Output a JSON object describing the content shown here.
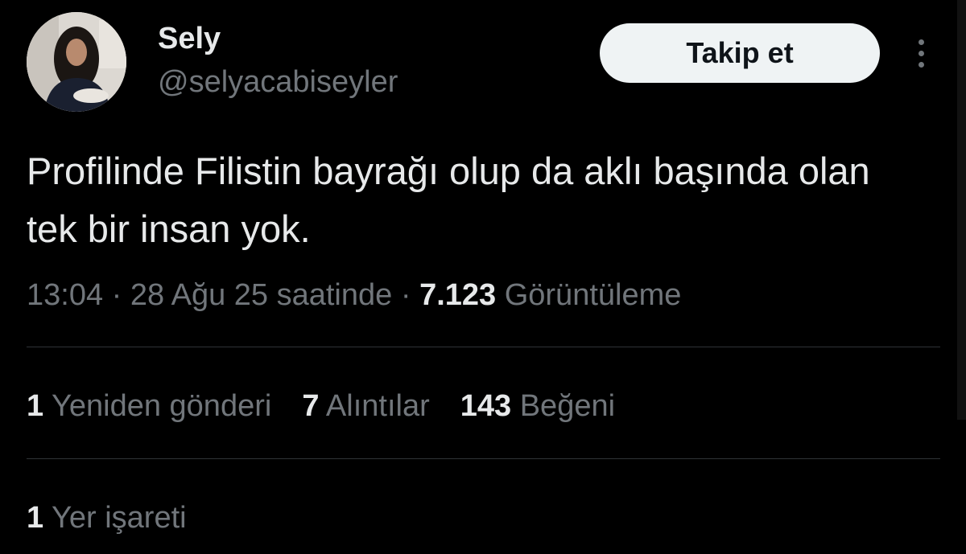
{
  "author": {
    "display_name": "Sely",
    "handle": "@selyacabiseyler",
    "avatar_icon": "user-avatar-photo"
  },
  "follow_button": {
    "label": "Takip et"
  },
  "more_icon": "more-vertical-icon",
  "tweet": {
    "text": "Profilinde Filistin bayrağı olup da aklı başında olan tek bir insan yok."
  },
  "meta": {
    "time": "13:04",
    "sep1": " · ",
    "date": "28 Ağu 25 saatinde",
    "sep2": " · ",
    "views_count": "7.123",
    "views_label": " Görüntüleme"
  },
  "stats": {
    "reposts": {
      "count": "1",
      "label": " Yeniden gönderi"
    },
    "quotes": {
      "count": "7",
      "label": " Alıntılar"
    },
    "likes": {
      "count": "143",
      "label": " Beğeni"
    },
    "bookmarks": {
      "count": "1",
      "label": " Yer işareti"
    }
  },
  "colors": {
    "background": "#000000",
    "primary_text": "#e7e9ea",
    "secondary_text": "#71767b",
    "divider": "#2f3336",
    "follow_button_bg": "#eff3f4"
  }
}
